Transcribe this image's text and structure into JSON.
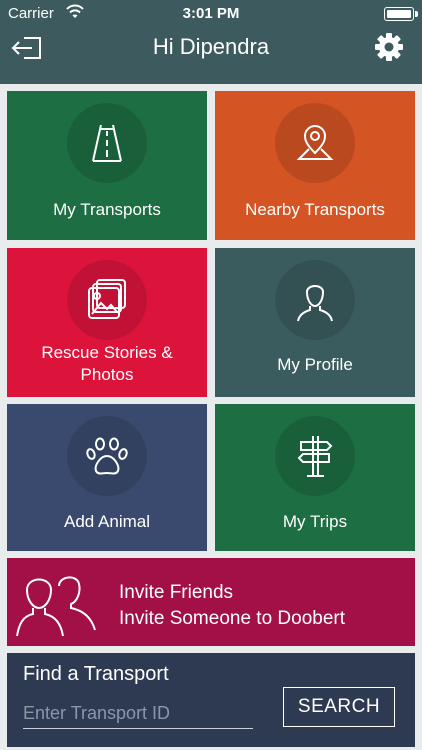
{
  "status_bar": {
    "carrier": "Carrier",
    "time": "3:01 PM"
  },
  "header": {
    "title": "Hi Dipendra",
    "logout_icon": "logout-icon",
    "settings_icon": "gear-icon"
  },
  "tiles": [
    {
      "label": "My Transports",
      "icon": "road-icon",
      "color": "#1d6e42"
    },
    {
      "label": "Nearby Transports",
      "icon": "location-pin-icon",
      "color": "#d55424"
    },
    {
      "label": "Rescue Stories & Photos",
      "icon": "photo-gallery-icon",
      "color": "#dc143c"
    },
    {
      "label": "My Profile",
      "icon": "person-icon",
      "color": "#3b5c5f"
    },
    {
      "label": "Add Animal",
      "icon": "paw-icon",
      "color": "#3a4a6e"
    },
    {
      "label": "My Trips",
      "icon": "signpost-icon",
      "color": "#1d6e42"
    }
  ],
  "invite": {
    "line1": "Invite Friends",
    "line2": "Invite Someone to Doobert",
    "icon": "people-icon",
    "color": "#a31048"
  },
  "find_transport": {
    "title": "Find a Transport",
    "placeholder": "Enter Transport ID",
    "value": "",
    "button_label": "SEARCH",
    "color": "#2e3a52"
  }
}
